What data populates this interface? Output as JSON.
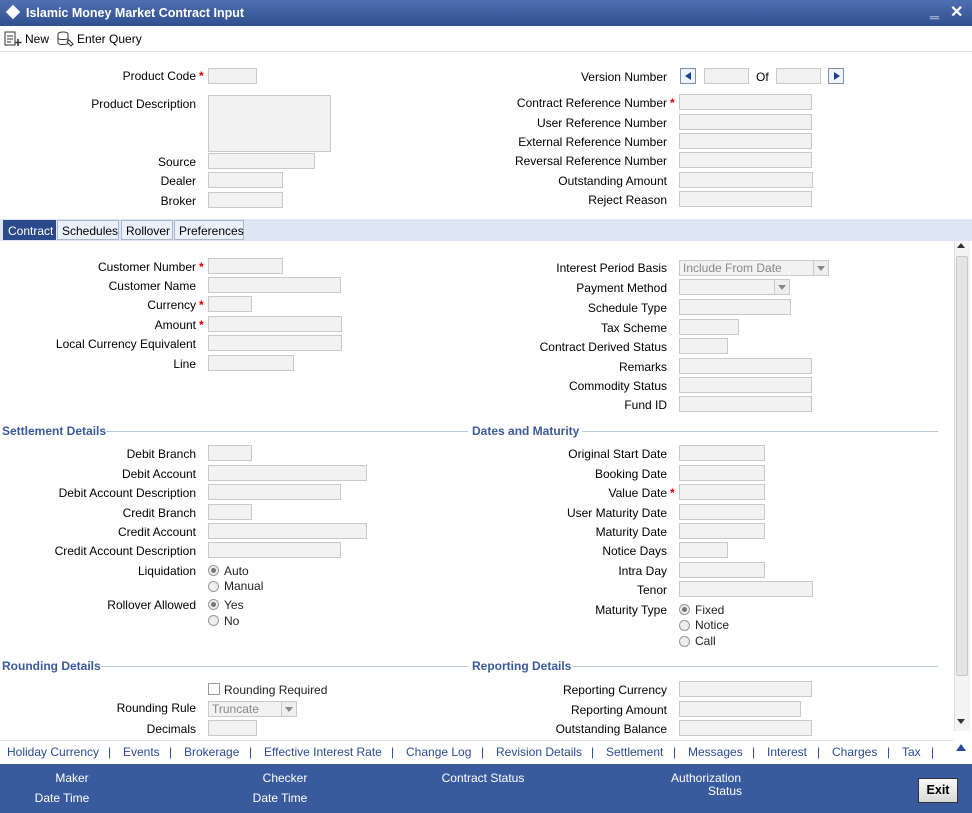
{
  "window": {
    "title": "Islamic Money Market Contract Input",
    "minimize": "‗",
    "close": "✕"
  },
  "toolbar": {
    "new_label": "New",
    "enter_query_label": "Enter Query"
  },
  "header": {
    "product_code": "Product Code",
    "product_description": "Product Description",
    "source": "Source",
    "dealer": "Dealer",
    "broker": "Broker",
    "version_number": "Version Number",
    "of": "Of",
    "contract_reference_number": "Contract Reference Number",
    "user_reference_number": "User Reference Number",
    "external_reference_number": "External Reference Number",
    "reversal_reference_number": "Reversal Reference Number",
    "outstanding_amount": "Outstanding Amount",
    "reject_reason": "Reject Reason",
    "required_mark": "*"
  },
  "tabs": [
    {
      "label": "Contract"
    },
    {
      "label": "Schedules"
    },
    {
      "label": "Rollover"
    },
    {
      "label": "Preferences"
    }
  ],
  "contract": {
    "customer_number": "Customer Number",
    "customer_name": "Customer Name",
    "currency": "Currency",
    "amount": "Amount",
    "local_currency_equivalent": "Local Currency Equivalent",
    "line": "Line",
    "interest_period_basis": "Interest Period Basis",
    "interest_period_basis_value": "Include From Date",
    "payment_method": "Payment Method",
    "schedule_type": "Schedule Type",
    "tax_scheme": "Tax Scheme",
    "contract_derived_status": "Contract Derived Status",
    "remarks": "Remarks",
    "commodity_status": "Commodity Status",
    "fund_id": "Fund ID"
  },
  "settlement": {
    "title": "Settlement Details",
    "debit_branch": "Debit Branch",
    "debit_account": "Debit Account",
    "debit_account_description": "Debit Account Description",
    "credit_branch": "Credit Branch",
    "credit_account": "Credit Account",
    "credit_account_description": "Credit Account Description",
    "liquidation": "Liquidation",
    "liquidation_auto": "Auto",
    "liquidation_manual": "Manual",
    "rollover_allowed": "Rollover Allowed",
    "rollover_yes": "Yes",
    "rollover_no": "No"
  },
  "dates": {
    "title": "Dates and Maturity",
    "original_start_date": "Original Start Date",
    "booking_date": "Booking Date",
    "value_date": "Value Date",
    "user_maturity_date": "User Maturity Date",
    "maturity_date": "Maturity Date",
    "notice_days": "Notice Days",
    "intra_day": "Intra Day",
    "tenor": "Tenor",
    "maturity_type": "Maturity Type",
    "maturity_fixed": "Fixed",
    "maturity_notice": "Notice",
    "maturity_call": "Call"
  },
  "rounding": {
    "title": "Rounding Details",
    "rounding_required": "Rounding Required",
    "rounding_rule": "Rounding Rule",
    "rounding_rule_value": "Truncate",
    "decimals": "Decimals"
  },
  "reporting": {
    "title": "Reporting Details",
    "reporting_currency": "Reporting Currency",
    "reporting_amount": "Reporting Amount",
    "outstanding_balance": "Outstanding Balance"
  },
  "links": [
    "Holiday Currency",
    "Events",
    "Brokerage",
    "Effective Interest Rate",
    "Change Log",
    "Revision Details",
    "Settlement",
    "Messages",
    "Interest",
    "Charges",
    "Tax"
  ],
  "link_separator": "|",
  "footer": {
    "maker": "Maker",
    "maker_date_time": "Date Time",
    "checker": "Checker",
    "checker_date_time": "Date Time",
    "contract_status": "Contract Status",
    "authorization": "Authorization",
    "authorization_status": "Status",
    "exit_label": "Exit"
  },
  "colors": {
    "title_bar": "#3a5a9e",
    "active_tab": "#2a4a8c",
    "section_heading": "#3a5a9a",
    "link": "#2a4a9a",
    "required": "#dd0000"
  }
}
